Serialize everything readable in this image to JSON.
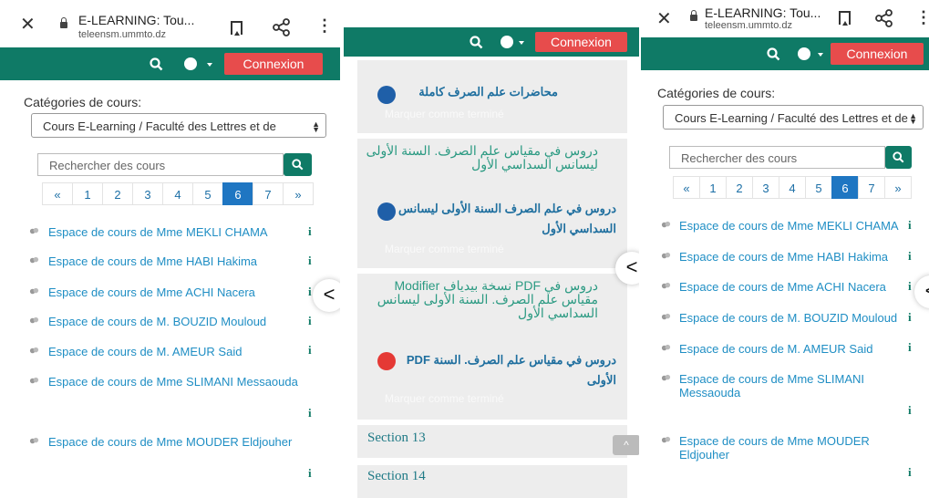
{
  "browser": {
    "close_glyph": "✕",
    "page_title": "E-LEARNING: Tou...",
    "host": "teleensm.ummto.dz",
    "more_glyph": "⋮"
  },
  "navbar": {
    "connexion_label": "Connexion",
    "color": "#0f7a66",
    "connexion_color": "#e74c4c"
  },
  "categories": {
    "label": "Catégories de cours:",
    "selected": "Cours E-Learning / Faculté des Lettres et de",
    "search_placeholder": "Rechercher des cours"
  },
  "pagination": [
    "«",
    "1",
    "2",
    "3",
    "4",
    "5",
    "6",
    "7",
    "»"
  ],
  "pagination_active": "6",
  "courses": [
    "Espace de cours de Mme MEKLI CHAMA",
    "Espace de cours de Mme HABI Hakima",
    "Espace de cours de Mme ACHI Nacera",
    "Espace de cours de M. BOUZID Mouloud",
    "Espace de cours de M. AMEUR Said",
    "Espace de cours de Mme SLIMANI Messaouda",
    "Espace de cours de Mme MOUDER Eldjouher"
  ],
  "info_glyph": "i",
  "chevron_glyph": "<",
  "middle": {
    "res1_title": "محاضرات علم الصرف كاملة",
    "mark_done": "Marquer comme terminé",
    "head1": "دروس في مقياس علم الصرف. السنة الأولى ليسانس السداسي الأول",
    "res2_title": "دروس في علم الصرف السنة الأولى ليسانس السداسي الأول",
    "head2": "دروس في PDF نسخة بيدياف Modifier مقياس علم الصرف. السنة الأولى ليسانس السداسي الأول",
    "res3_title": "دروس في مقياس علم الصرف. السنة PDF الأولى",
    "section13": "Section 13",
    "section14": "Section 14",
    "scroll_top_glyph": "^"
  },
  "colors": {
    "link": "#1f8ec4",
    "pager_active": "#1f76c2",
    "pdf_icon": "#e53935",
    "doc_icon": "#1f5fa8"
  }
}
